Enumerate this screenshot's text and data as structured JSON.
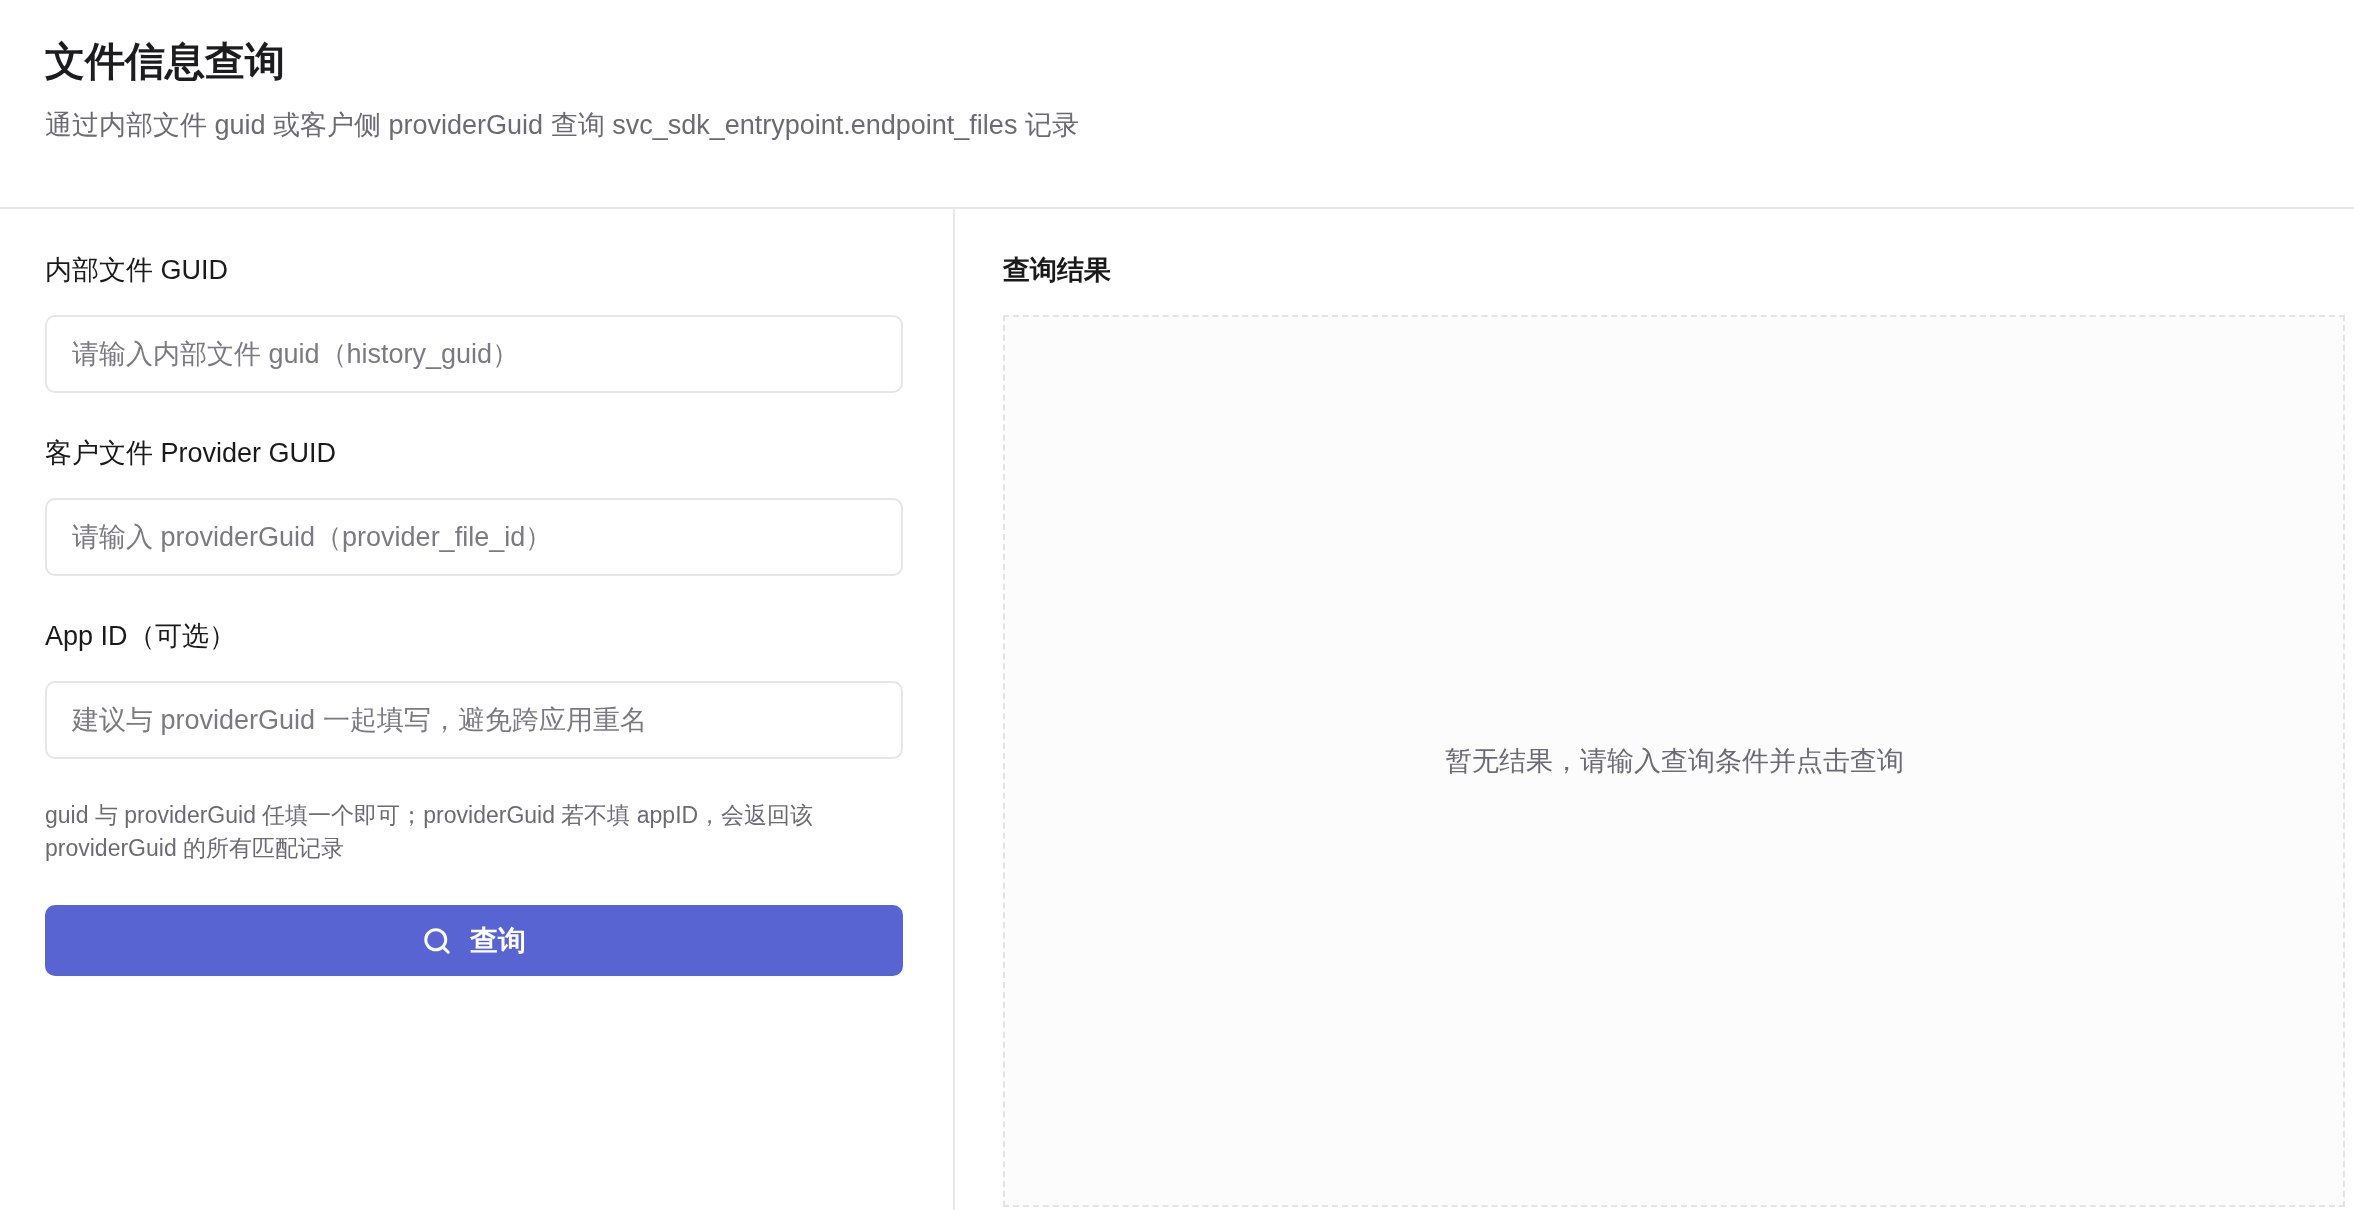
{
  "header": {
    "title": "文件信息查询",
    "subtitle": "通过内部文件 guid 或客户侧 providerGuid 查询 svc_sdk_entrypoint.endpoint_files 记录"
  },
  "form": {
    "fields": [
      {
        "label": "内部文件 GUID",
        "placeholder": "请输入内部文件 guid（history_guid）"
      },
      {
        "label": "客户文件 Provider GUID",
        "placeholder": "请输入 providerGuid（provider_file_id）"
      },
      {
        "label": "App ID（可选）",
        "placeholder": "建议与 providerGuid 一起填写，避免跨应用重名"
      }
    ],
    "hint": "guid 与 providerGuid 任填一个即可；providerGuid 若不填 appID，会返回该 providerGuid 的所有匹配记录",
    "submit_button": {
      "label": "查询"
    }
  },
  "results": {
    "title": "查询结果",
    "empty_message": "暂无结果，请输入查询条件并点击查询"
  }
}
